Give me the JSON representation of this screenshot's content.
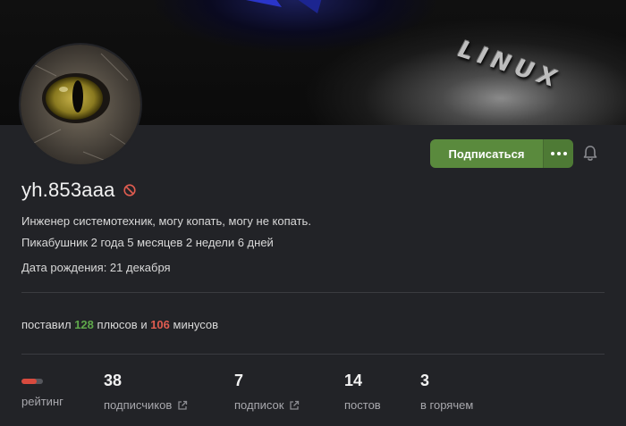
{
  "banner": {
    "text": "LINUX"
  },
  "profile": {
    "username": "yh.853aaa",
    "bio": "Инженер системотехник, могу копать, могу не копать.",
    "member_for": "Пикабушник 2 года 5 месяцев 2 недели 6 дней",
    "birthday": "Дата рождения: 21 декабря"
  },
  "actions": {
    "subscribe_label": "Подписаться"
  },
  "votes": {
    "prefix": "поставил",
    "plus_count": "128",
    "plus_word": "плюсов",
    "conj": "и",
    "minus_count": "106",
    "minus_word": "минусов"
  },
  "stats": {
    "rating": {
      "label": "рейтинг",
      "bar_fill_fraction": 0.7
    },
    "subscribers": {
      "value": "38",
      "label": "подписчиков"
    },
    "subscriptions": {
      "value": "7",
      "label": "подписок"
    },
    "posts": {
      "value": "14",
      "label": "постов"
    },
    "hot": {
      "value": "3",
      "label": "в горячем"
    }
  },
  "colors": {
    "accent_green": "#5a8a3d",
    "plus_green": "#5fa84b",
    "minus_red": "#e05c50",
    "rating_red": "#d84a3e"
  },
  "icons": [
    "more-dots-icon",
    "bell-icon",
    "ban-icon",
    "external-link-icon",
    "avatar-cat-eye"
  ]
}
